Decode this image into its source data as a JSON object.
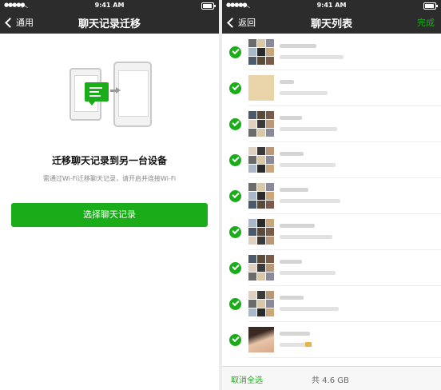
{
  "status_bar": {
    "signal": "●●●●●",
    "time": "9:41 AM"
  },
  "left_screen": {
    "back_label": "通用",
    "title": "聊天记录迁移",
    "heading": "迁移聊天记录到另一台设备",
    "description": "需通过Wi-Fi迁移聊天记录，请开启并连接Wi-Fi",
    "select_button_label": "选择聊天记录"
  },
  "right_screen": {
    "back_label": "返回",
    "title": "聊天列表",
    "done_label": "完成",
    "chat_count": 9,
    "footer": {
      "cancel_all_label": "取消全选",
      "total_size": "共 4.6 GB"
    }
  },
  "colors": {
    "accent": "#1aad19",
    "nav_bg": "#2c2c2c"
  },
  "icons": {
    "back": "chevron-left-icon",
    "selected": "check-circle-icon",
    "wifi": "wifi-icon",
    "battery": "battery-icon"
  }
}
